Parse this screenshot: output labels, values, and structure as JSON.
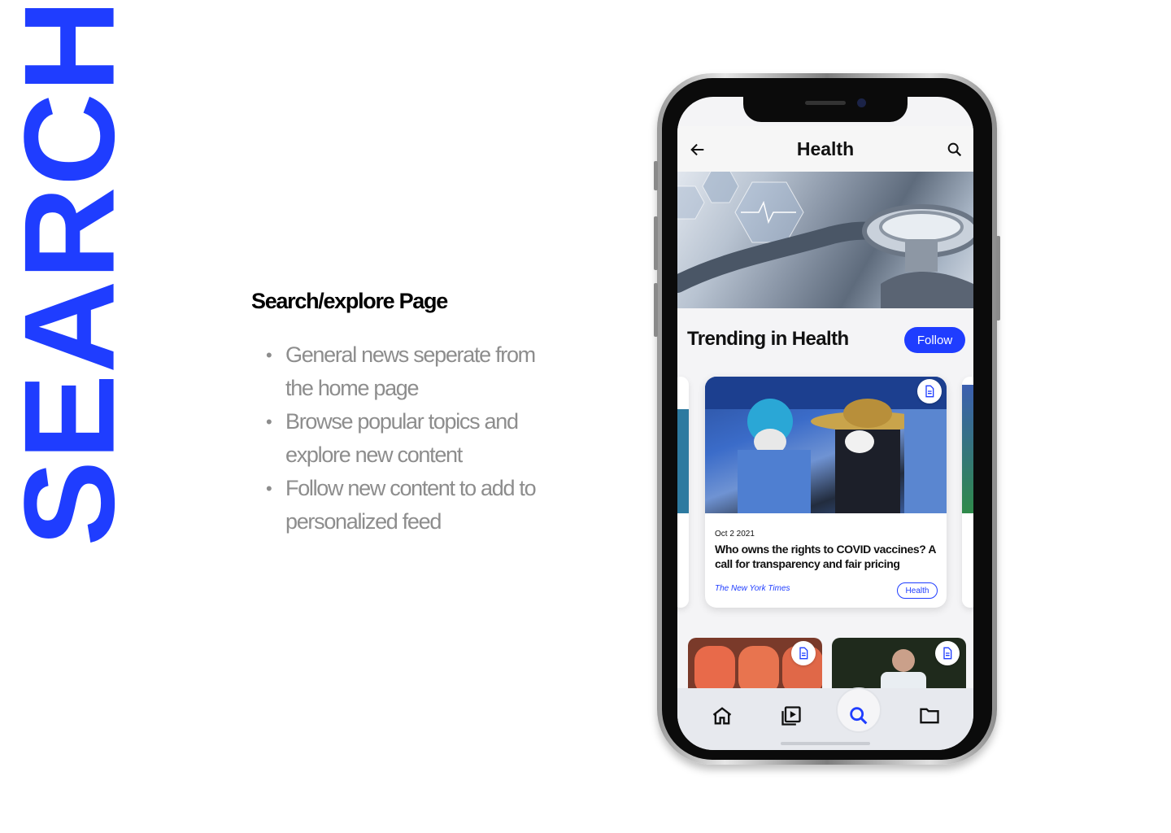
{
  "side_title": "SEARCH",
  "description": {
    "title": "Search/explore Page",
    "bullets": [
      "General news seperate from the home page",
      "Browse popular topics and explore new content",
      "Follow new content to add to personalized feed"
    ]
  },
  "app": {
    "header": {
      "title": "Health",
      "back_icon": "arrow-left-icon",
      "search_icon": "search-icon"
    },
    "section": {
      "title": "Trending in Health",
      "follow_label": "Follow"
    },
    "featured_card": {
      "date": "Oct 2 2021",
      "headline": "Who owns the rights to COVID vaccines? A call for transparency and fair pricing",
      "source": "The New York Times",
      "tag": "Health",
      "badge_icon": "document-icon"
    },
    "tabbar": {
      "items": [
        {
          "icon": "home-icon",
          "active": false
        },
        {
          "icon": "video-library-icon",
          "active": false
        },
        {
          "icon": "search-icon",
          "active": true
        },
        {
          "icon": "folder-icon",
          "active": false
        }
      ]
    }
  },
  "colors": {
    "accent": "#1f3dff",
    "muted_text": "#8d8d8d"
  }
}
